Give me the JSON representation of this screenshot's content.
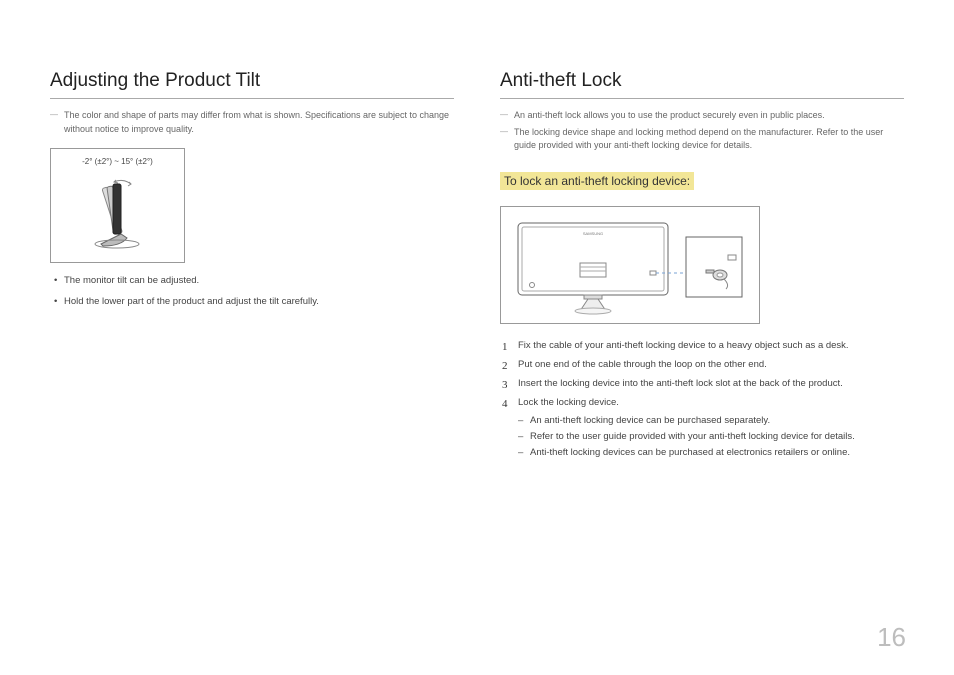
{
  "left": {
    "heading": "Adjusting the Product Tilt",
    "note": "The color and shape of parts may differ from what is shown. Specifications are subject to change without notice to improve quality.",
    "tilt_caption": "-2° (±2°) ~ 15° (±2°)",
    "bullets": [
      "The monitor tilt can be adjusted.",
      "Hold the lower part of the product and adjust the tilt carefully."
    ]
  },
  "right": {
    "heading": "Anti-theft Lock",
    "notes": [
      "An anti-theft lock allows you to use the product securely even in public places.",
      "The locking device shape and locking method depend on the manufacturer. Refer to the user guide provided with your anti-theft locking device for details."
    ],
    "subheading": "To lock an anti-theft locking device:",
    "monitor_brand": "SAMSUNG",
    "steps": [
      "Fix the cable of your anti-theft locking device to a heavy object such as a desk.",
      "Put one end of the cable through the loop on the other end.",
      "Insert the locking device into the anti-theft lock slot at the back of the product.",
      "Lock the locking device."
    ],
    "substeps": [
      "An anti-theft locking device can be purchased separately.",
      "Refer to the user guide provided with your anti-theft locking device for details.",
      "Anti-theft locking devices can be purchased at electronics retailers or online."
    ]
  },
  "page_number": "16"
}
